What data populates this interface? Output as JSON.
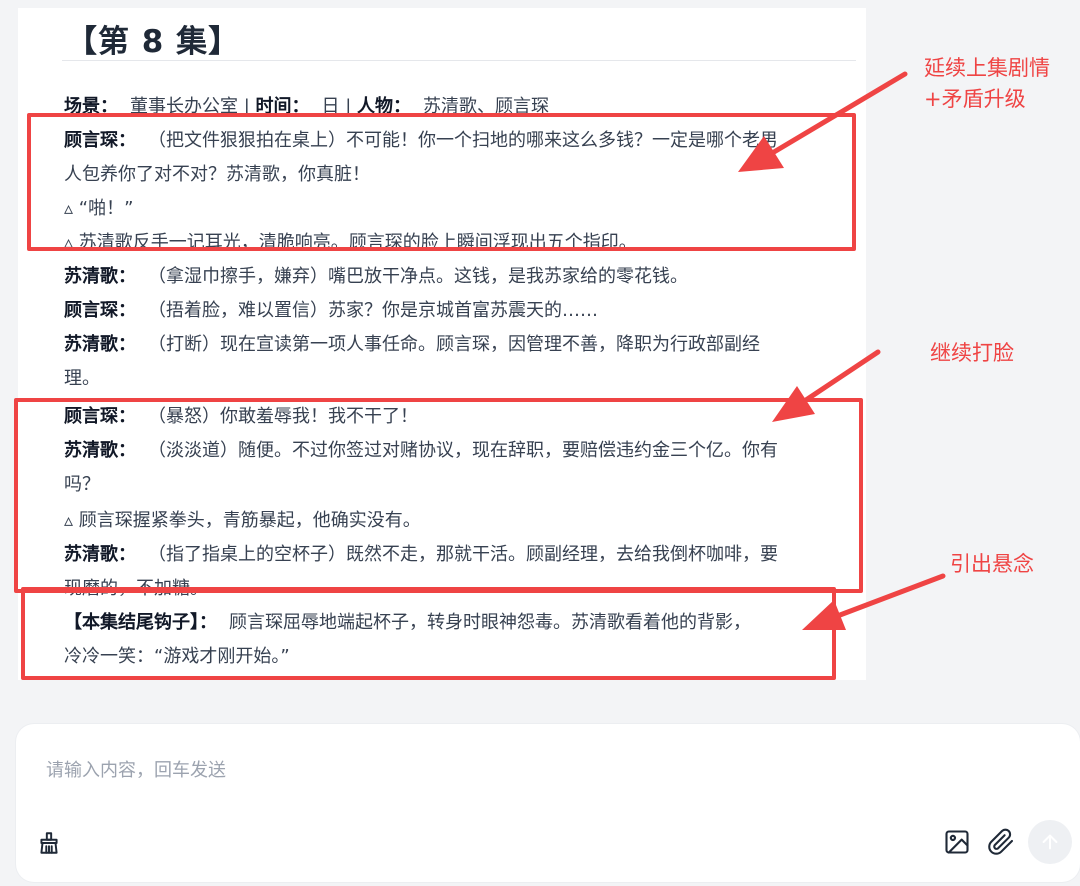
{
  "episode": {
    "title": "【第 8 集】",
    "scene_line": {
      "scene_label": "场景：",
      "scene_value": "董事长办公室 | ",
      "time_label": "时间：",
      "time_value": "日 | ",
      "people_label": "人物：",
      "people_value": "苏清歌、顾言琛"
    },
    "lines": [
      {
        "speaker": "顾言琛：",
        "text": "（把文件狠狠拍在桌上）不可能！你一个扫地的哪来这么多钱？一定是哪个老男"
      },
      {
        "speaker": "",
        "text": "人包养你了对不对？苏清歌，你真脏！"
      },
      {
        "speaker": "",
        "text": "▵ “啪！”"
      },
      {
        "speaker": "",
        "text": "▵ 苏清歌反手一记耳光，清脆响亮。顾言琛的脸上瞬间浮现出五个指印。"
      },
      {
        "speaker": "苏清歌：",
        "text": "（拿湿巾擦手，嫌弃）嘴巴放干净点。这钱，是我苏家给的零花钱。"
      },
      {
        "speaker": "顾言琛：",
        "text": "（捂着脸，难以置信）苏家？你是京城首富苏震天的……"
      },
      {
        "speaker": "苏清歌：",
        "text": "（打断）现在宣读第一项人事任命。顾言琛，因管理不善，降职为行政部副经"
      },
      {
        "speaker": "",
        "text": "理。"
      },
      {
        "speaker": "顾言琛：",
        "text": "（暴怒）你敢羞辱我！我不干了！"
      },
      {
        "speaker": "苏清歌：",
        "text": "（淡淡道）随便。不过你签过对赌协议，现在辞职，要赔偿违约金三个亿。你有"
      },
      {
        "speaker": "",
        "text": "吗？"
      },
      {
        "speaker": "",
        "text": "▵ 顾言琛握紧拳头，青筋暴起，他确实没有。"
      },
      {
        "speaker": "苏清歌：",
        "text": "（指了指桌上的空杯子）既然不走，那就干活。顾副经理，去给我倒杯咖啡，要"
      },
      {
        "speaker": "",
        "text": "现磨的，不加糖。"
      },
      {
        "speaker": "【本集结尾钩子】：",
        "text": "顾言琛屈辱地端起杯子，转身时眼神怨毒。苏清歌看着他的背影，"
      },
      {
        "speaker": "",
        "text": "冷冷一笑：“游戏才刚开始。”"
      }
    ]
  },
  "annotations": {
    "first": "延续上集剧情\n+矛盾升级",
    "second": "继续打脸",
    "third": "引出悬念"
  },
  "composer": {
    "placeholder": "请输入内容，回车发送"
  },
  "icons": {
    "broom": "broom-icon",
    "image": "image-icon",
    "attach": "paperclip-icon",
    "send": "arrow-up-icon"
  },
  "colors": {
    "annotation_red": "#ef4444",
    "send_disabled_bg": "#eef0f3"
  }
}
